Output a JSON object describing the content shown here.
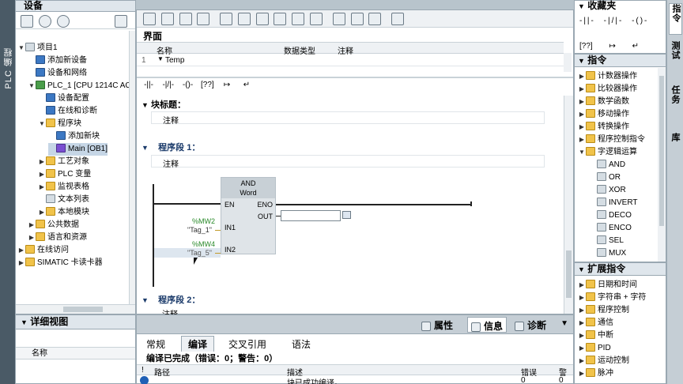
{
  "left_tab": "PLC 编程",
  "project_tree": {
    "title": "设备",
    "items": [
      {
        "label": "项目1",
        "indent": 0,
        "expanded": true,
        "icon": "plain"
      },
      {
        "label": "添加新设备",
        "indent": 1,
        "icon": "dev"
      },
      {
        "label": "设备和网络",
        "indent": 1,
        "icon": "dev"
      },
      {
        "label": "PLC_1 [CPU 1214C AC/",
        "indent": 1,
        "expanded": true,
        "icon": "green"
      },
      {
        "label": "设备配置",
        "indent": 2,
        "icon": "dev"
      },
      {
        "label": "在线和诊断",
        "indent": 2,
        "icon": "dev"
      },
      {
        "label": "程序块",
        "indent": 2,
        "expanded": true,
        "icon": "folder"
      },
      {
        "label": "添加新块",
        "indent": 3,
        "icon": "dev"
      },
      {
        "label": "Main [OB1]",
        "indent": 3,
        "icon": "blk",
        "selected": true
      },
      {
        "label": "工艺对象",
        "indent": 2,
        "collapsed": true,
        "icon": "folder"
      },
      {
        "label": "PLC 变量",
        "indent": 2,
        "collapsed": true,
        "icon": "folder"
      },
      {
        "label": "监视表格",
        "indent": 2,
        "collapsed": true,
        "icon": "folder"
      },
      {
        "label": "文本列表",
        "indent": 2,
        "icon": "plain"
      },
      {
        "label": "本地模块",
        "indent": 2,
        "collapsed": true,
        "icon": "folder"
      },
      {
        "label": "公共数据",
        "indent": 1,
        "collapsed": true,
        "icon": "folder"
      },
      {
        "label": "语言和资源",
        "indent": 1,
        "collapsed": true,
        "icon": "folder"
      },
      {
        "label": "在线访问",
        "indent": 0,
        "collapsed": true,
        "icon": "folder"
      },
      {
        "label": "SIMATIC 卡读卡器",
        "indent": 0,
        "collapsed": true,
        "icon": "folder"
      }
    ]
  },
  "detail_view": {
    "title": "详细视图",
    "column": "名称"
  },
  "editor": {
    "interface_title": "界面",
    "columns": [
      "名称",
      "数据类型",
      "注释"
    ],
    "row": {
      "num": "1",
      "name": "Temp"
    },
    "ladder_buttons": [
      "-||-",
      "-|/|-",
      "-()-",
      "[??]",
      "↦",
      "↵"
    ],
    "block_title": "块标题：",
    "block_comment": "注释",
    "network1_title": "程序段 1：",
    "network1_comment": "注释",
    "network2_title": "程序段 2：",
    "network2_comment": "注释",
    "box": {
      "line1": "AND",
      "line2": "Word",
      "en": "EN",
      "eno": "ENO",
      "out": "OUT",
      "in1": "IN1",
      "in2": "IN2"
    },
    "in1_addr": "%MW2",
    "in1_tag": "\"Tag_1\"",
    "in2_addr": "%MW4",
    "in2_tag": "\"Tag_5\""
  },
  "inspector": {
    "tabs_top": [
      "属性",
      "信息",
      "诊断"
    ],
    "tabs": [
      "常规",
      "编译",
      "交叉引用",
      "语法"
    ],
    "status": "编译已完成（错误：0；警告：0）",
    "columns": [
      "路径",
      "描述",
      "错误",
      "警"
    ],
    "row_text": "块已成功编译。",
    "row_err": "0",
    "row_warn": "0"
  },
  "right": {
    "favorites_title": "收藏夹",
    "instructions_title": "指令",
    "instr_items": [
      {
        "label": "计数器操作",
        "icon": "+1"
      },
      {
        "label": "比较器操作",
        "icon": "cmp"
      },
      {
        "label": "数学函数",
        "icon": "±"
      },
      {
        "label": "移动操作",
        "icon": "mv"
      },
      {
        "label": "转换操作",
        "icon": "cv"
      },
      {
        "label": "程序控制指令",
        "icon": "jmp"
      },
      {
        "label": "字逻辑运算",
        "icon": "DB",
        "expanded": true
      }
    ],
    "logic_items": [
      "AND",
      "OR",
      "XOR",
      "INVERT",
      "DECO",
      "ENCO",
      "SEL",
      "MUX"
    ],
    "ext_title": "扩展指令",
    "ext_items": [
      "日期和时间",
      "字符串 + 字符",
      "程序控制",
      "通信",
      "中断",
      "PID",
      "运动控制",
      "脉冲"
    ],
    "side_tabs": [
      "指令",
      "测试",
      "任务",
      "库"
    ]
  }
}
